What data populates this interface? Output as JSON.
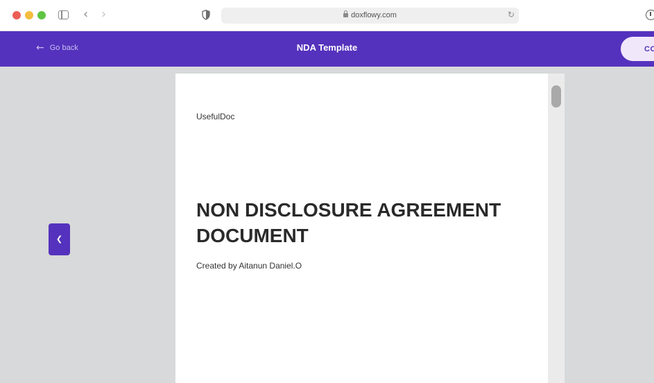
{
  "browser": {
    "url": "doxflowy.com",
    "icons": {
      "sidebar": "sidebar-icon",
      "back": "chevron-left-icon",
      "forward": "chevron-right-icon",
      "shield": "shield-icon",
      "lock": "lock-icon",
      "reload": "reload-icon",
      "download": "download-icon"
    }
  },
  "header": {
    "back_label": "Go back",
    "title": "NDA Template",
    "cta_label": "CO",
    "colors": {
      "brand": "#5532bd",
      "cta_bg": "#f1e7fb"
    }
  },
  "document": {
    "brand": "UsefulDoc",
    "title": "NON DISCLOSURE AGREEMENT DOCUMENT",
    "author": "Created by Aitanun Daniel.O"
  },
  "controls": {
    "prev_icon": "chevron-left-icon"
  }
}
